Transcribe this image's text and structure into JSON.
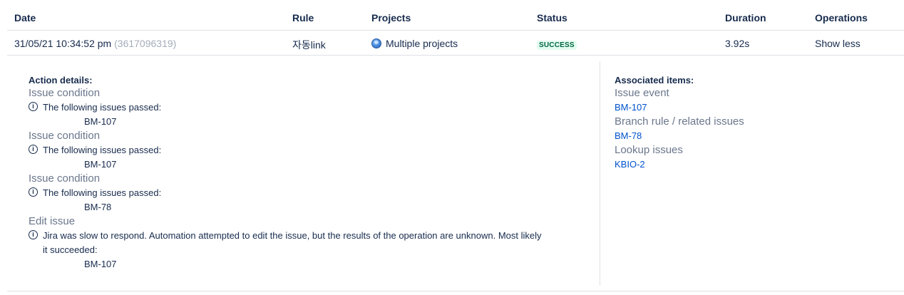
{
  "columns": {
    "date": "Date",
    "rule": "Rule",
    "projects": "Projects",
    "status": "Status",
    "duration": "Duration",
    "operations": "Operations"
  },
  "row": {
    "date": "31/05/21 10:34:52 pm",
    "id": "(3617096319)",
    "rule": "자동link",
    "projects": "Multiple projects",
    "status": "SUCCESS",
    "duration": "3.92s",
    "operation": "Show less"
  },
  "details": {
    "action_title": "Action details:",
    "actions": [
      {
        "title": "Issue condition",
        "message": "The following issues passed:",
        "issue": "BM-107"
      },
      {
        "title": "Issue condition",
        "message": "The following issues passed:",
        "issue": "BM-107"
      },
      {
        "title": "Issue condition",
        "message": "The following issues passed:",
        "issue": "BM-78"
      },
      {
        "title": "Edit issue",
        "message_line1": "Jira was slow to respond. Automation attempted to edit the issue, but the results of the operation are unknown. Most likely",
        "message_line2": "it succeeded:",
        "issue": "BM-107"
      }
    ],
    "associated_title": "Associated items:",
    "associated": [
      {
        "title": "Issue event",
        "link": "BM-107"
      },
      {
        "title": "Branch rule / related issues",
        "link": "BM-78"
      },
      {
        "title": "Lookup issues",
        "link": "KBIO-2"
      }
    ]
  },
  "icons": {
    "info": "info-circle-icon",
    "project": "globe-icon"
  },
  "colors": {
    "link": "#0052cc",
    "success_text": "#006644",
    "success_bg": "#e3fcef"
  }
}
